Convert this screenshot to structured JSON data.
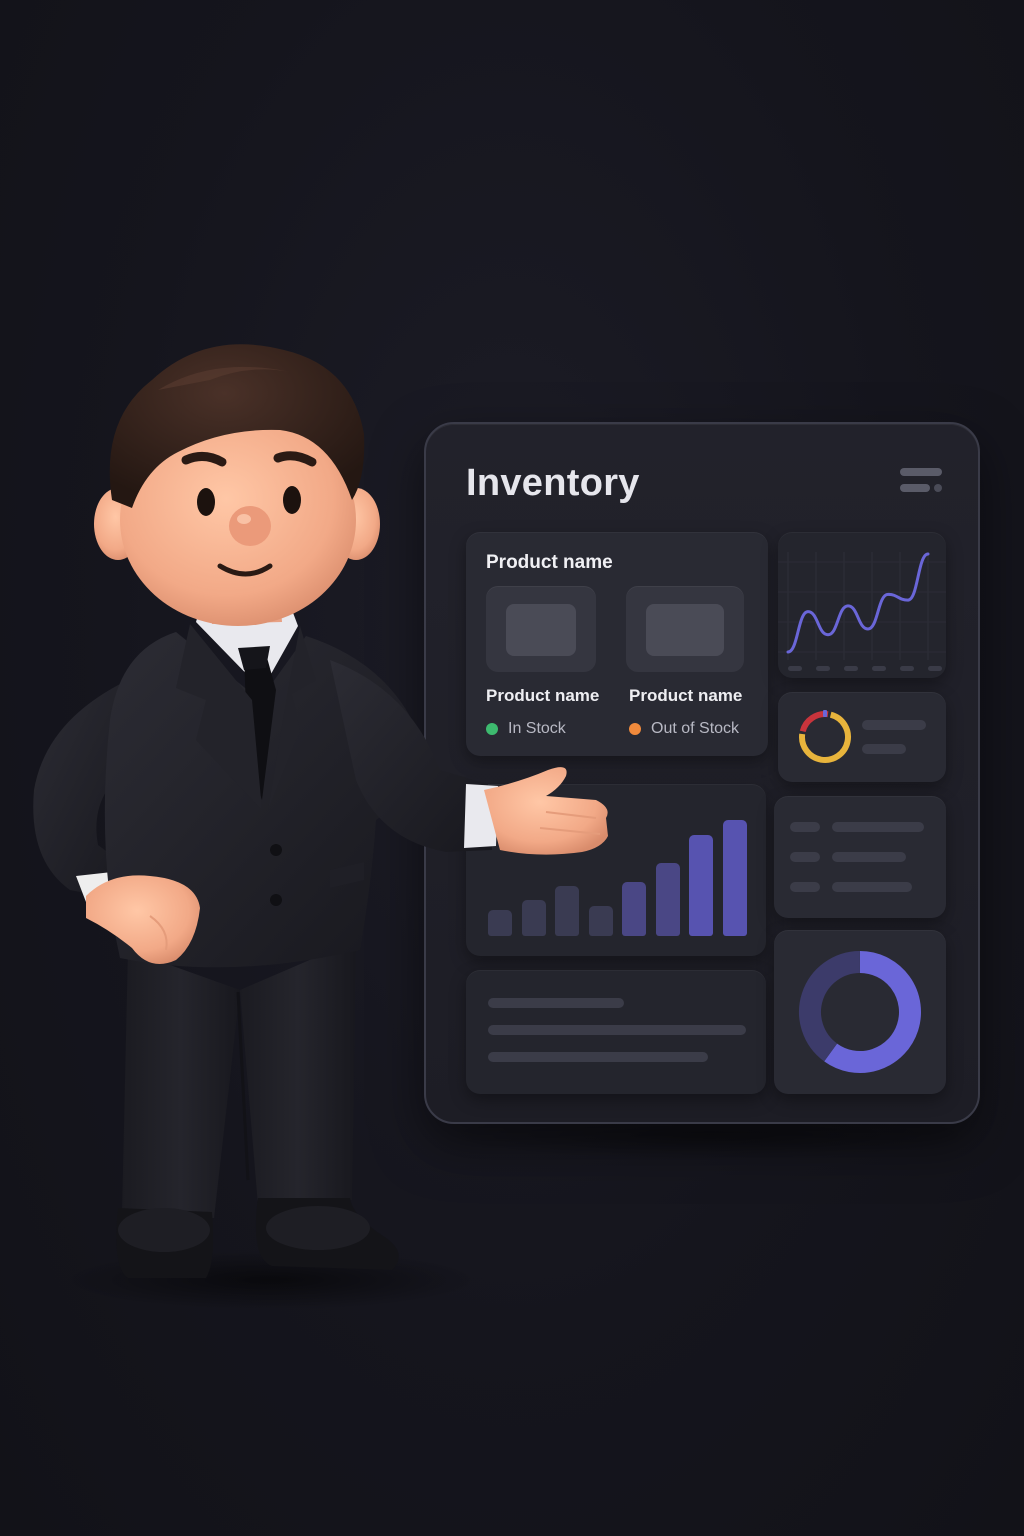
{
  "dashboard": {
    "title": "Inventory",
    "product_card": {
      "title": "Product name",
      "products": [
        {
          "name": "Product name",
          "status": "In Stock",
          "status_color": "#3dba6f"
        },
        {
          "name": "Product name",
          "status": "Out of Stock",
          "status_color": "#f08a3c"
        }
      ]
    },
    "icons": [
      "menu-icon"
    ]
  },
  "colors": {
    "accent": "#6a66d8",
    "accent_dark": "#4a4785",
    "in_stock": "#3dba6f",
    "out_of_stock": "#f08a3c",
    "ring_red": "#c8343c",
    "ring_yellow": "#e8b43c"
  },
  "chart_data": [
    {
      "type": "line",
      "y": [
        12,
        26,
        18,
        28,
        20,
        32,
        30,
        46
      ],
      "grid": true
    },
    {
      "type": "bar",
      "values": [
        26,
        36,
        50,
        30,
        54,
        72,
        100,
        115
      ]
    },
    {
      "type": "pie",
      "values": [
        75,
        25
      ]
    },
    {
      "type": "pie",
      "values": [
        60,
        40
      ]
    }
  ]
}
